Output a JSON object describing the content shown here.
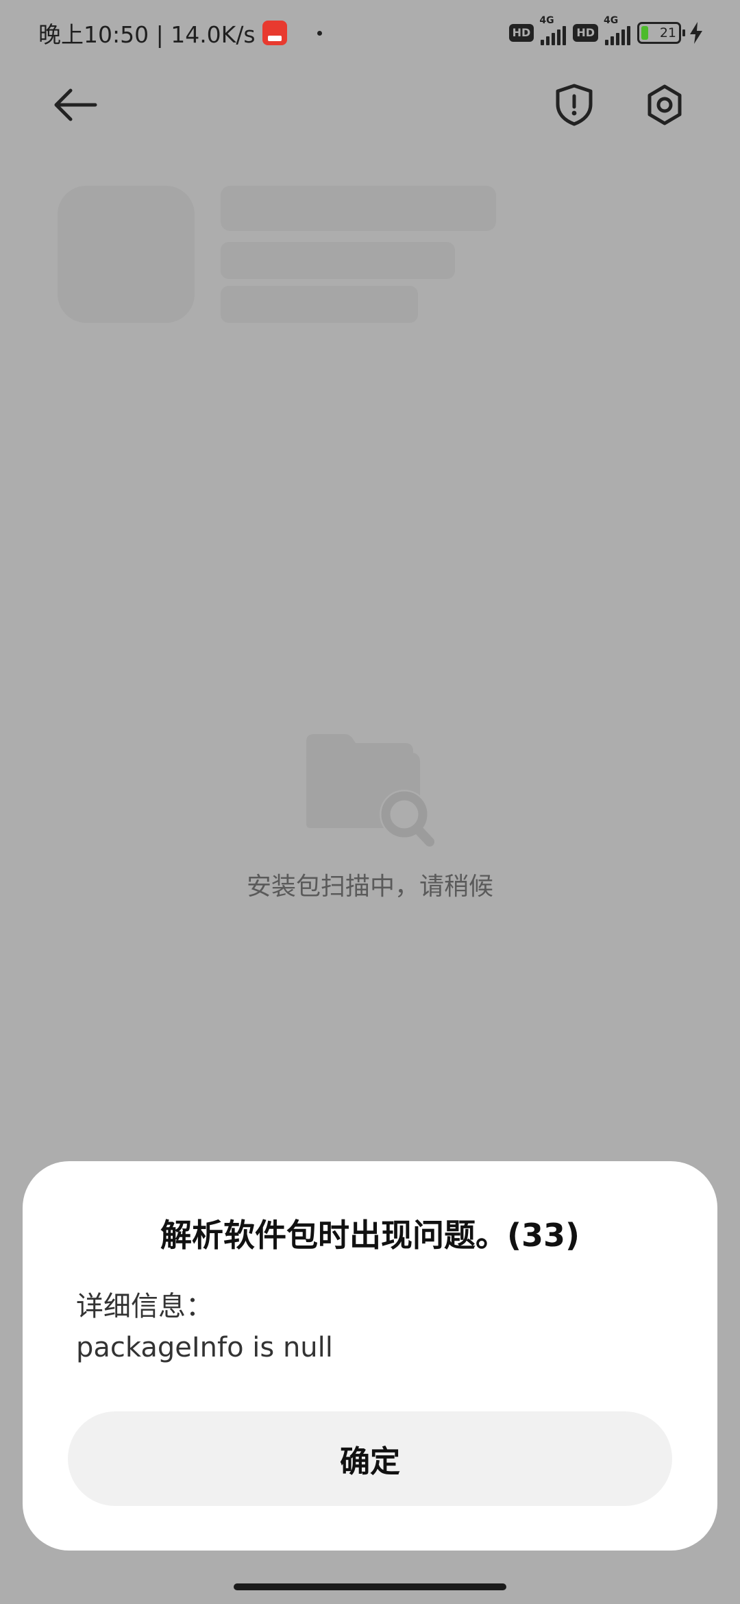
{
  "status_bar": {
    "time_speed": "晚上10:50 | 14.0K/s",
    "hd1": "HD",
    "net1": "4G",
    "hd2": "HD",
    "net2": "4G",
    "battery": "21",
    "battery_color": "#4dbb2b"
  },
  "toolbar": {
    "back_icon": "arrow-left",
    "security_icon": "shield-exclamation",
    "settings_icon": "gear"
  },
  "scan": {
    "icon": "folder-search",
    "status_text": "安装包扫描中，请稍候"
  },
  "dialog": {
    "title": "解析软件包时出现问题。(33)",
    "detail_label": "详细信息：",
    "detail_value": "packageInfo is null",
    "confirm_label": "确定"
  }
}
